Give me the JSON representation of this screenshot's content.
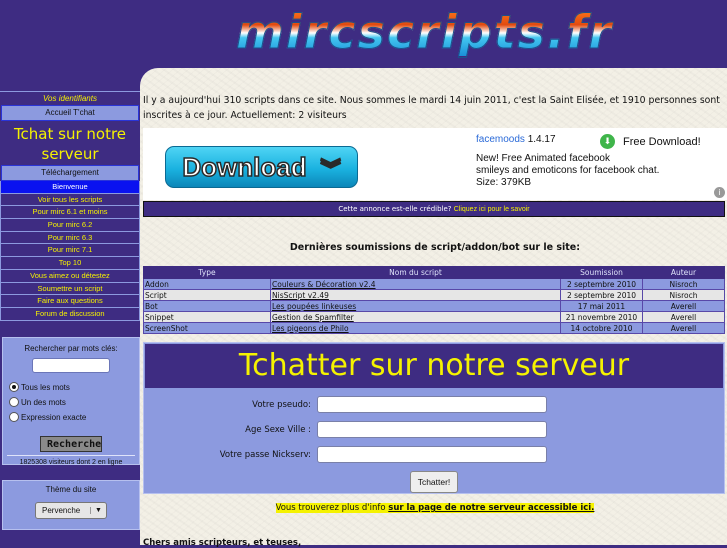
{
  "header": {
    "logo_text": "mircscripts.fr"
  },
  "sidebar": {
    "ident_title": "Vos identifiants",
    "accueil_tchat": "Accueil T'chat",
    "tchat_heading": "Tchat sur notre serveur",
    "telechargement": "Téléchargement",
    "nav": [
      {
        "label": "Bienvenue",
        "active": true
      },
      {
        "label": "Voir tous les scripts"
      },
      {
        "label": "Pour mirc 6.1 et moins"
      },
      {
        "label": "Pour mirc 6.2"
      },
      {
        "label": "Pour mirc 6.3"
      },
      {
        "label": "Pour mirc 7.1"
      },
      {
        "label": "Top 10"
      },
      {
        "label": "Vous aimez ou détestez"
      },
      {
        "label": "Soumettre un script"
      },
      {
        "label": "Faire aux questions"
      },
      {
        "label": "Forum de discussion"
      }
    ],
    "search": {
      "label": "Rechercher par mots clés:",
      "value": "",
      "options": [
        {
          "label": "Tous les mots",
          "checked": true
        },
        {
          "label": "Un des mots",
          "checked": false
        },
        {
          "label": "Expression exacte",
          "checked": false
        }
      ],
      "button": "Recherche",
      "visitors": "1825308 visiteurs dont 2 en ligne"
    },
    "theme": {
      "label": "Thème du site",
      "selected": "Pervenche"
    }
  },
  "main": {
    "intro": "Il y a aujourd'hui 310 scripts dans ce site. Nous sommes le mardi 14 juin 2011, c'est la Saint Elisée, et 1910 personnes sont inscrites à ce jour. Actuellement: 2 visiteurs",
    "ad": {
      "button": "Download",
      "brand": "facemoods",
      "version": " 1.4.17",
      "free_download": "Free Download!",
      "desc1": "New! Free Animated facebook",
      "desc2": "smileys and emoticons for facebook chat.",
      "size": "Size: 379KB",
      "info_icon": "i"
    },
    "ad_bar": {
      "text": "Cette annonce est-elle crédible? ",
      "link": "Cliquez ici pour le savoir"
    },
    "latest": {
      "title": "Dernières soumissions de script/addon/bot sur le site:",
      "columns": [
        "Type",
        "Nom du script",
        "Soumission",
        "Auteur"
      ],
      "rows": [
        [
          "Addon",
          "Couleurs & Décoration v2.4",
          "2 septembre 2010",
          "Nisroch"
        ],
        [
          "Script",
          "NisScript v2.49",
          "2 septembre 2010",
          "Nisroch"
        ],
        [
          "Bot",
          "Les poupées linkeuses",
          "17 mai 2011",
          "Averell"
        ],
        [
          "Snippet",
          "Gestion de Spamfilter",
          "21 novembre 2010",
          "Averell"
        ],
        [
          "ScreenShot",
          "Les pigeons de Philo",
          "14 octobre 2010",
          "Averell"
        ]
      ]
    },
    "chat": {
      "title": "Tchatter sur notre serveur",
      "pseudo_label": "Votre pseudo:",
      "asv_label": "Age Sexe Ville :",
      "pass_label": "Votre passe Nickserv:",
      "pseudo_value": "",
      "asv_value": "",
      "pass_value": "",
      "button": "Tchatter!"
    },
    "more_info": {
      "text": "Vous trouverez plus d'info ",
      "link": "sur la page de notre serveur accessible ici."
    },
    "footer_text": "Chers amis scripteurs, et teuses,"
  }
}
